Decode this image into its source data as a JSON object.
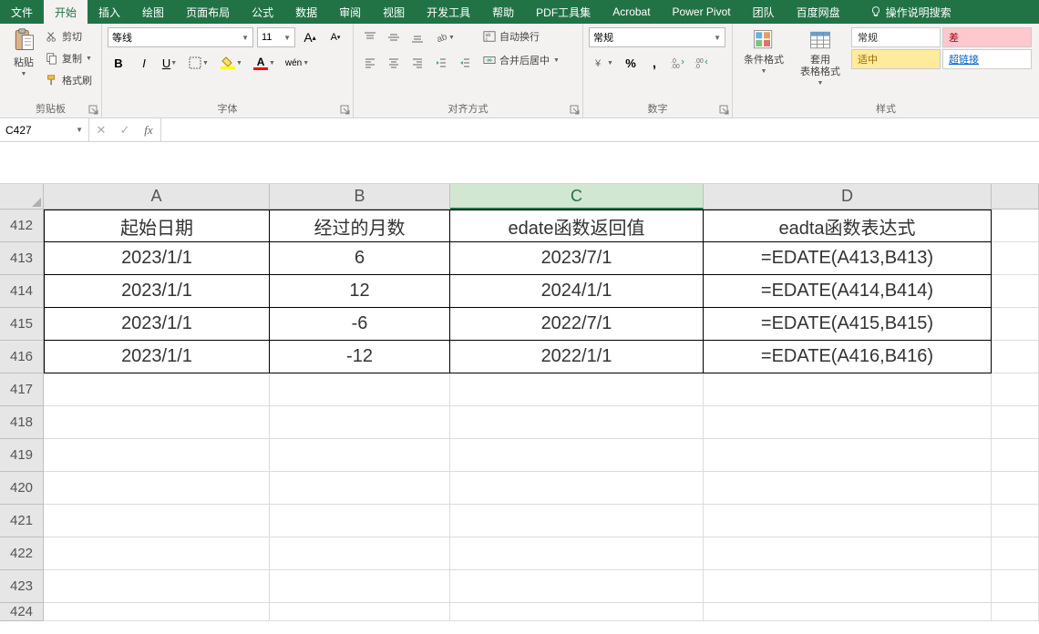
{
  "ribbon": {
    "tabs": [
      "文件",
      "开始",
      "插入",
      "绘图",
      "页面布局",
      "公式",
      "数据",
      "审阅",
      "视图",
      "开发工具",
      "帮助",
      "PDF工具集",
      "Acrobat",
      "Power Pivot",
      "团队",
      "百度网盘"
    ],
    "active_tab_index": 1,
    "search_label": "操作说明搜索"
  },
  "clipboard": {
    "group_label": "剪贴板",
    "paste": "粘贴",
    "cut": "剪切",
    "copy": "复制",
    "format_painter": "格式刷"
  },
  "font": {
    "group_label": "字体",
    "font_name": "等线",
    "font_size": "11"
  },
  "alignment": {
    "group_label": "对齐方式",
    "wrap": "自动换行",
    "merge": "合并后居中"
  },
  "number": {
    "group_label": "数字",
    "format": "常规"
  },
  "styles": {
    "group_label": "样式",
    "cond_fmt": "条件格式",
    "table_fmt": "套用\n表格格式",
    "normal": "常规",
    "bad": "差",
    "good": "适中",
    "link": "超链接"
  },
  "formula_bar": {
    "namebox": "C427",
    "formula": ""
  },
  "columns": [
    "A",
    "B",
    "C",
    "D"
  ],
  "selected_col": 2,
  "row_nums": [
    "412",
    "413",
    "414",
    "415",
    "416",
    "417",
    "418",
    "419",
    "420",
    "421",
    "422",
    "423",
    "424"
  ],
  "data": [
    [
      "起始日期",
      "经过的月数",
      "edate函数返回值",
      "eadta函数表达式"
    ],
    [
      "2023/1/1",
      "6",
      "2023/7/1",
      "=EDATE(A413,B413)"
    ],
    [
      "2023/1/1",
      "12",
      "2024/1/1",
      "=EDATE(A414,B414)"
    ],
    [
      "2023/1/1",
      "-6",
      "2022/7/1",
      "=EDATE(A415,B415)"
    ],
    [
      "2023/1/1",
      "-12",
      "2022/1/1",
      "=EDATE(A416,B416)"
    ]
  ]
}
